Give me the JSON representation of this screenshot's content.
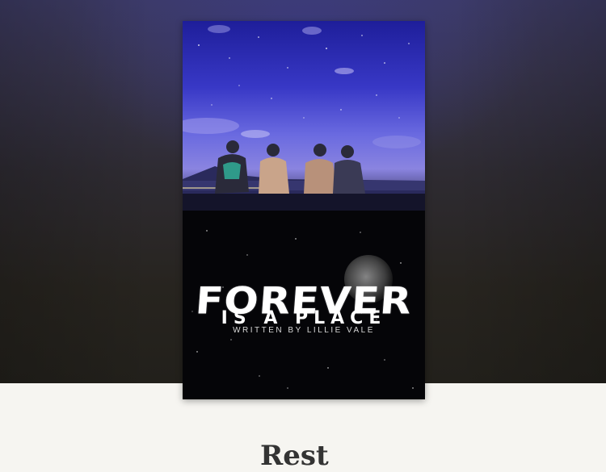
{
  "cover": {
    "title": "FOREVER",
    "subtitle": "IS A PLACE",
    "author_line": "WRITTEN BY LILLIE VALE"
  },
  "page": {
    "heading": "Rest"
  },
  "colors": {
    "page_background": "#f6f5f1",
    "hero_background": "#2a2723",
    "sky_top": "#2a2ab8",
    "sky_bottom": "#6b6bd8"
  }
}
